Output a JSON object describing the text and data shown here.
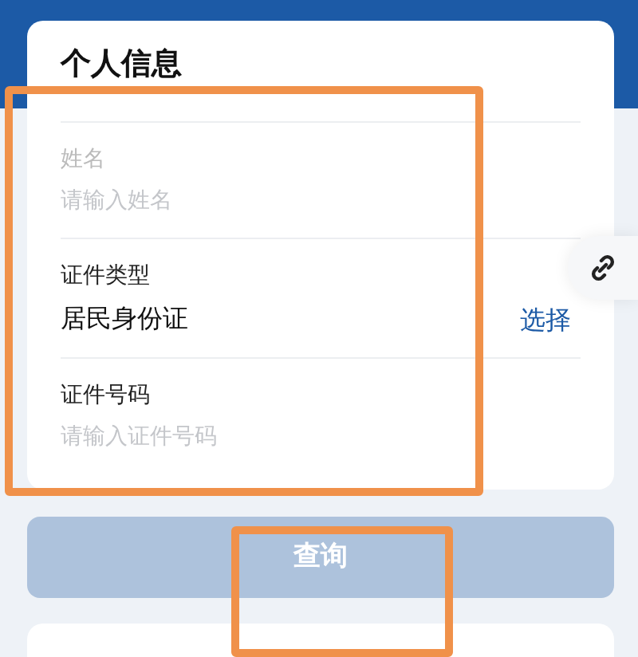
{
  "card": {
    "title": "个人信息",
    "fields": [
      {
        "kind": "input",
        "label": "姓名",
        "placeholder": "请输入姓名"
      },
      {
        "kind": "select",
        "label": "证件类型",
        "value": "居民身份证",
        "action": "选择"
      },
      {
        "kind": "input",
        "label": "证件号码",
        "placeholder": "请输入证件号码"
      }
    ]
  },
  "query_button": {
    "label": "查询",
    "disabled": true
  },
  "highlights": [
    {
      "kind": "frame"
    },
    {
      "kind": "frame"
    }
  ]
}
